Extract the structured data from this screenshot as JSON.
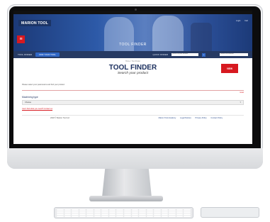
{
  "site": {
    "brand": "MARION TOOL",
    "menu_icon": "hamburger-icon",
    "hero_title": "TOOL FINDER",
    "hero_links": [
      "Login",
      "Cart"
    ]
  },
  "navbar": {
    "tool_finder_label": "TOOL FINDER",
    "find_tool_button": "FIND YOUR TOOL",
    "quick_finder_label": "QUICK FINDER",
    "quick_finder_placeholder": "Search by part number",
    "go_label": "»",
    "search_placeholder": "Search our website"
  },
  "breadcrumb": "Home  /  Tool Finder",
  "page": {
    "title": "TOOL FINDER",
    "subtitle": "Search your product",
    "cta_label": "VIEW",
    "instructions": "Please select your parameters and find your product",
    "reset_label": "reset",
    "machining_type_label": "Machining type",
    "machining_type_value": "Choose",
    "help_link": "Can't find what you need? Contact us"
  },
  "footer": {
    "copyright": "2018 © Marion Tool Ltd",
    "links": [
      "Marion Tool Academy",
      "Legal Notices",
      "Privacy Policy",
      "Contact Policy"
    ]
  },
  "colors": {
    "brand_red": "#d71920",
    "brand_navy": "#1b2f5e",
    "nav_blue": "#2f66c6"
  }
}
